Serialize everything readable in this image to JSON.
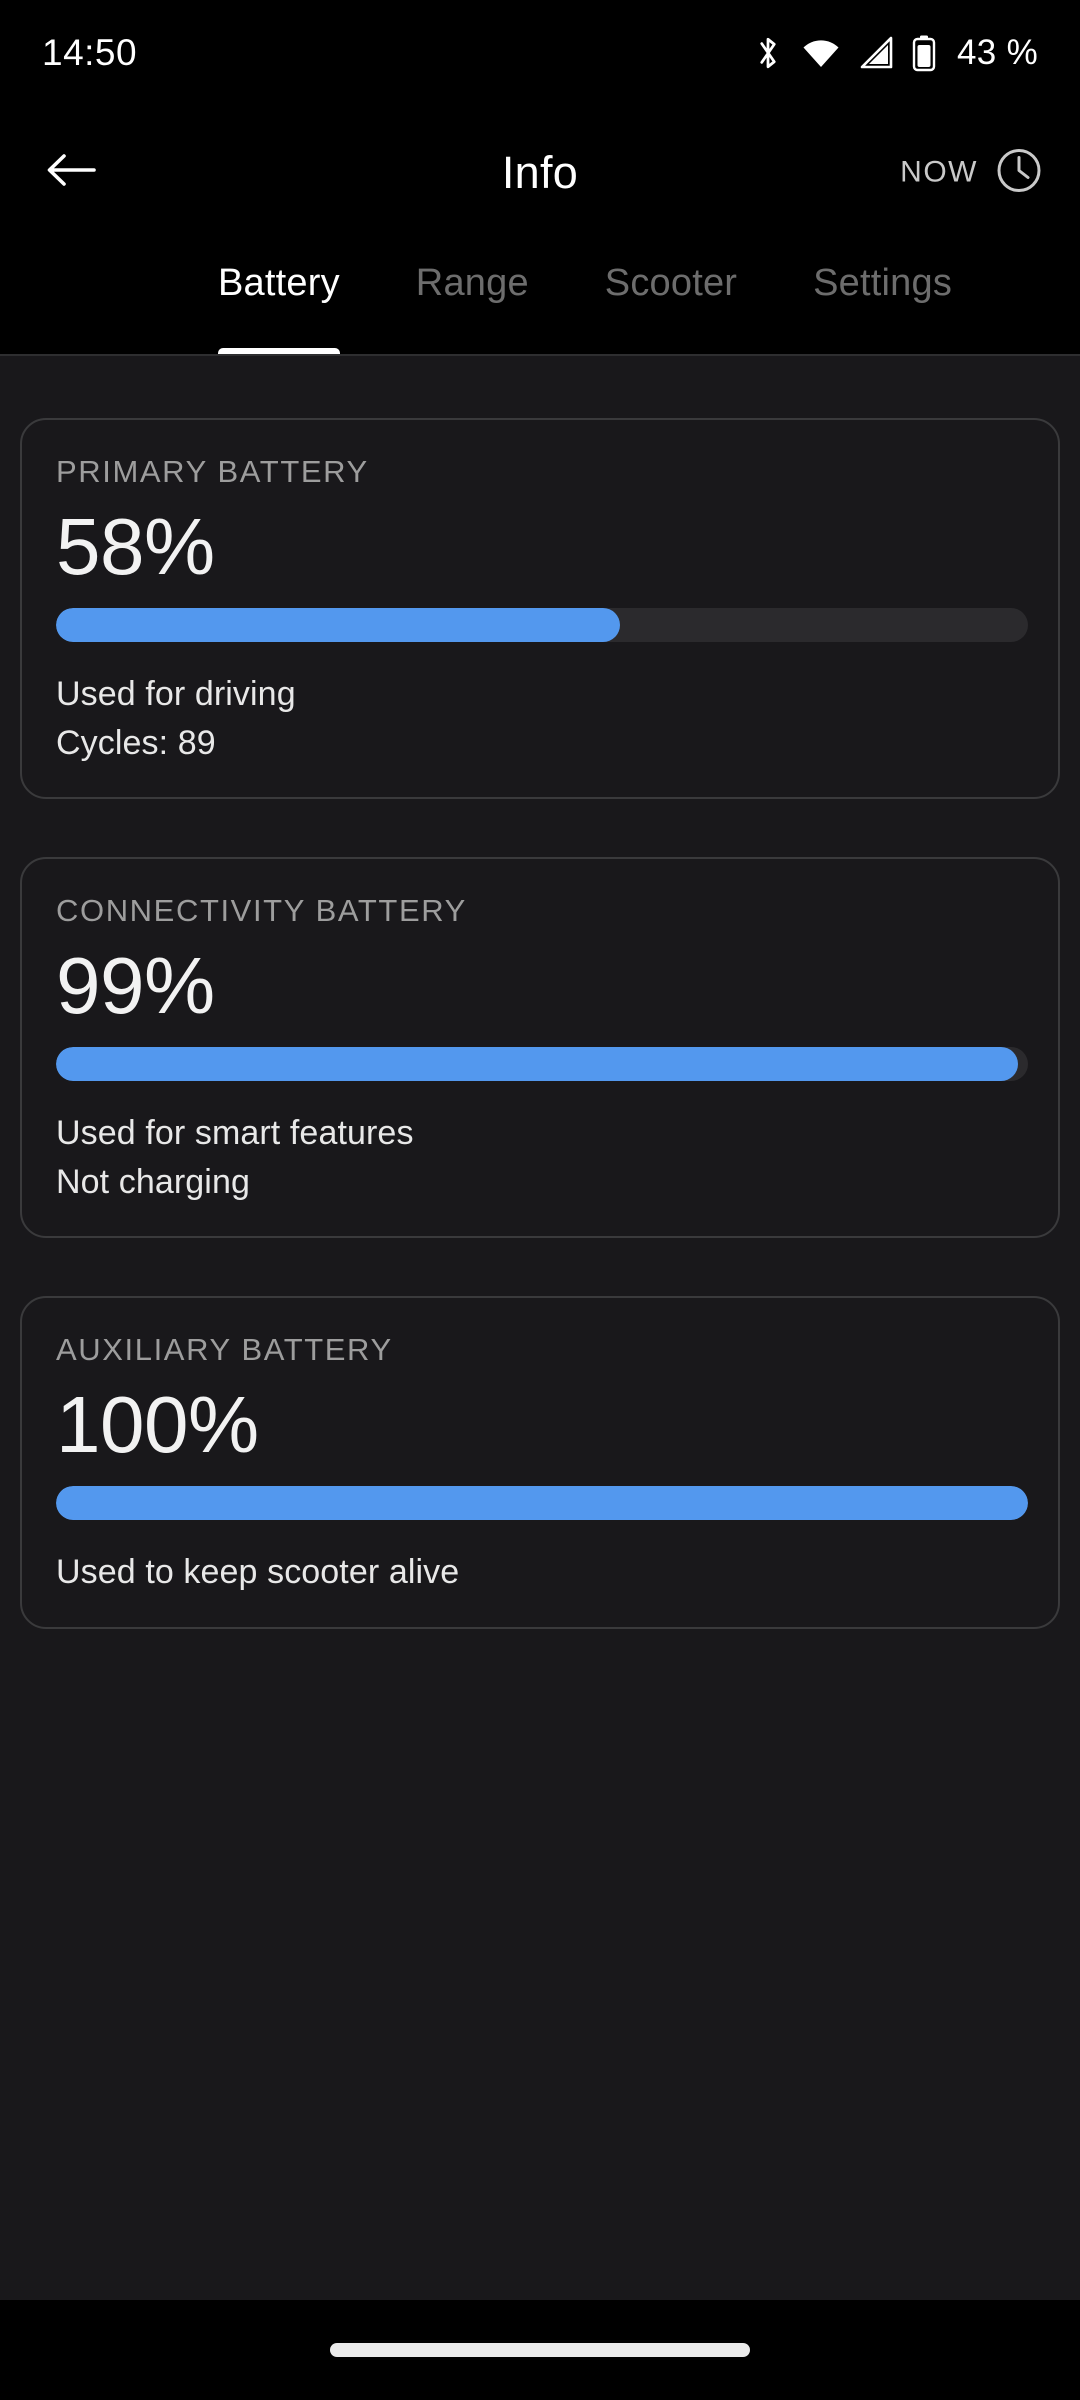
{
  "status_bar": {
    "time": "14:50",
    "battery_percent": "43 %",
    "icons": [
      "bluetooth-icon",
      "wifi-icon",
      "cellular-signal-icon",
      "battery-icon"
    ]
  },
  "header": {
    "back_icon": "back-arrow-icon",
    "title": "Info",
    "now_label": "NOW",
    "clock_icon": "clock-icon"
  },
  "tabs": [
    {
      "label": "Battery",
      "active": true
    },
    {
      "label": "Range",
      "active": false
    },
    {
      "label": "Scooter",
      "active": false
    },
    {
      "label": "Settings",
      "active": false
    }
  ],
  "colors": {
    "accent_blue": "#5398EE",
    "track_gray": "#2b2a2d",
    "content_bg": "#19181B",
    "card_border": "#3a3a3c",
    "muted_text": "#9d9d9d"
  },
  "cards": [
    {
      "title": "PRIMARY BATTERY",
      "value": "58%",
      "percent": 58,
      "line1": "Used for driving",
      "line2": "Cycles: 89"
    },
    {
      "title": "CONNECTIVITY BATTERY",
      "value": "99%",
      "percent": 99,
      "line1": "Used for smart features",
      "line2": "Not charging"
    },
    {
      "title": "AUXILIARY BATTERY",
      "value": "100%",
      "percent": 100,
      "line1": "Used to keep scooter alive",
      "line2": ""
    }
  ]
}
